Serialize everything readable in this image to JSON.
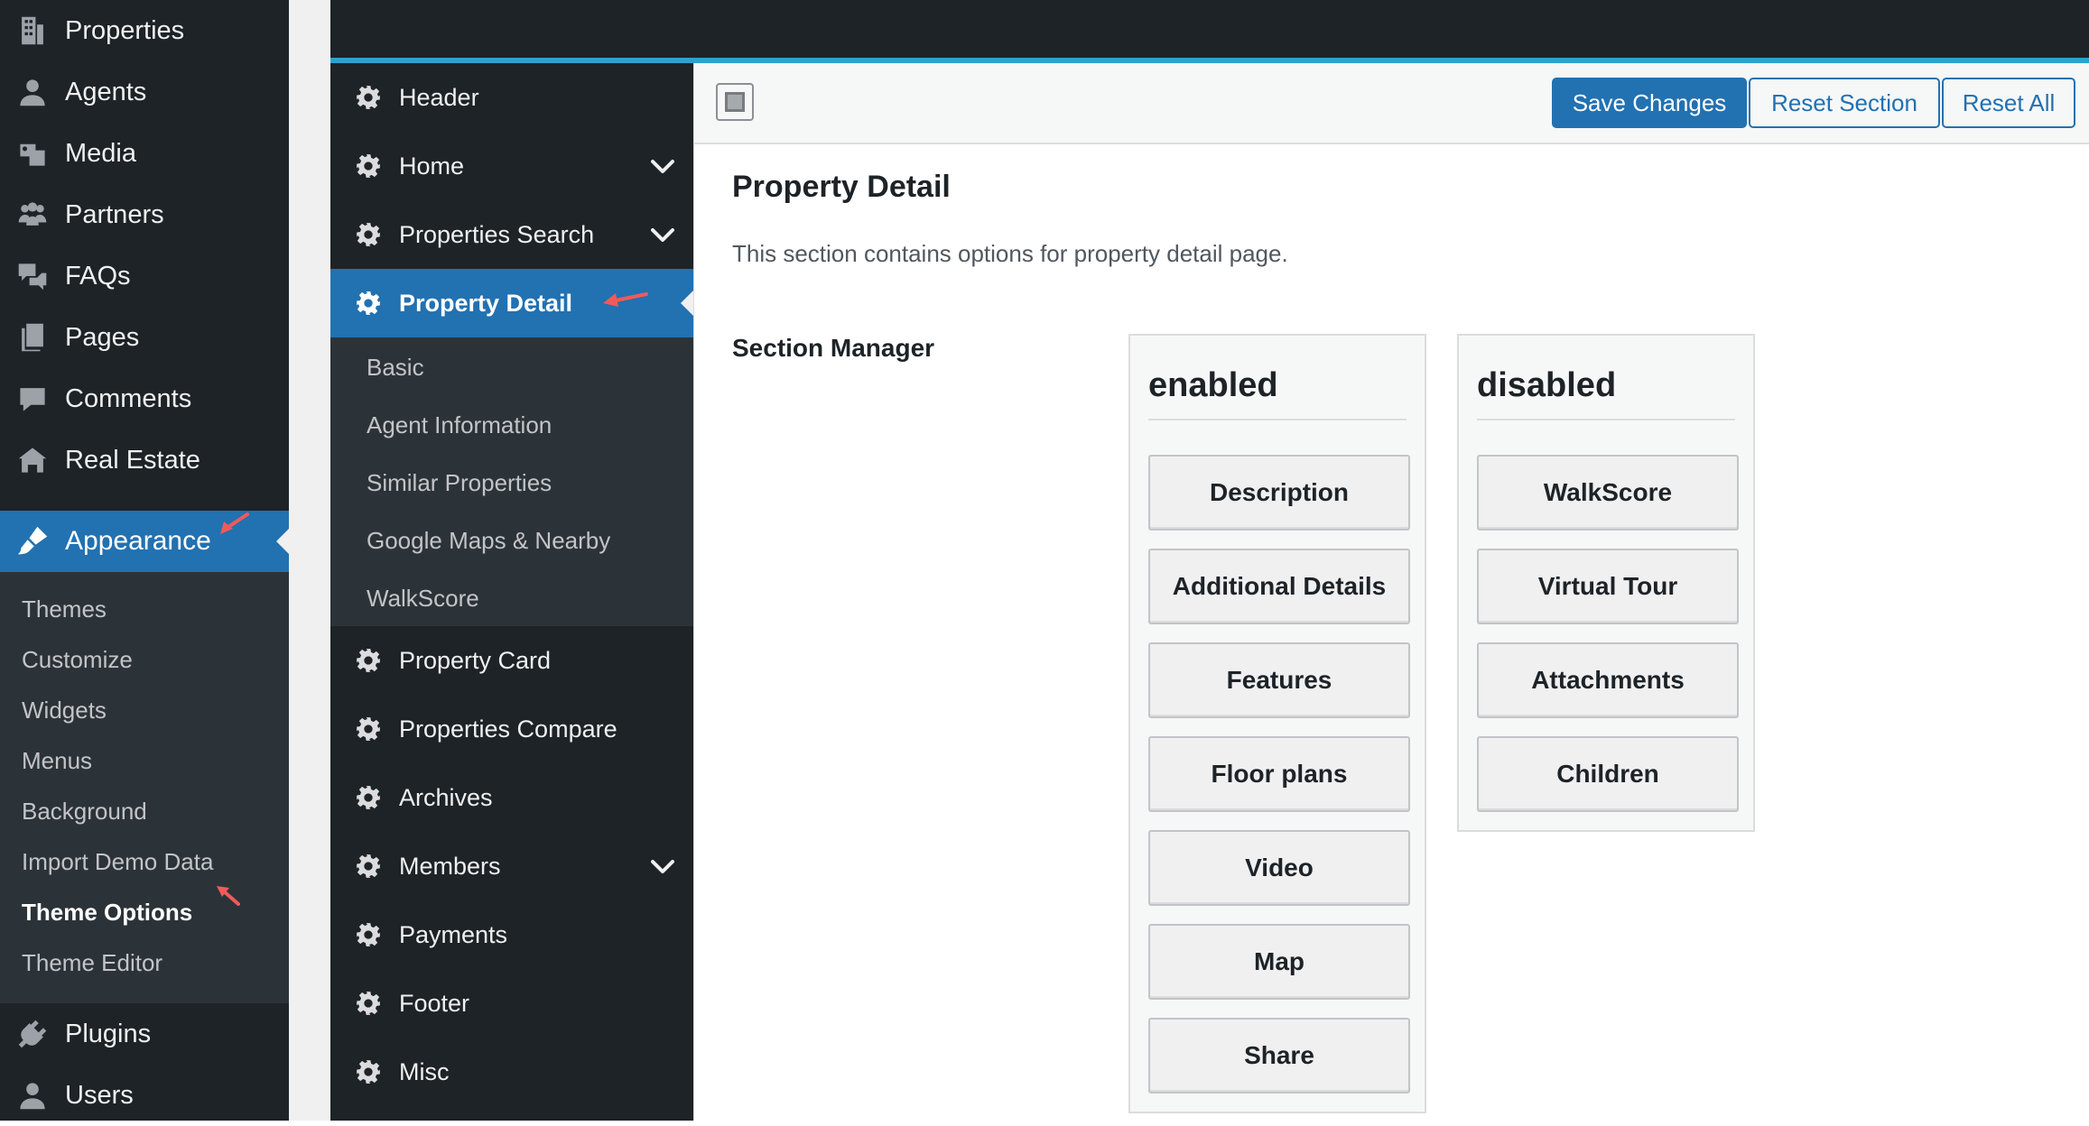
{
  "wp_menu": {
    "items_top": [
      {
        "label": "Properties",
        "icon": "building-icon"
      },
      {
        "label": "Agents",
        "icon": "person-icon"
      },
      {
        "label": "Media",
        "icon": "media-icon"
      },
      {
        "label": "Partners",
        "icon": "groups-icon"
      },
      {
        "label": "FAQs",
        "icon": "speech-bubbles-icon"
      },
      {
        "label": "Pages",
        "icon": "pages-icon"
      },
      {
        "label": "Comments",
        "icon": "comment-icon"
      },
      {
        "label": "Real Estate",
        "icon": "houses-icon"
      }
    ],
    "appearance": {
      "label": "Appearance",
      "icon": "paintbrush-icon"
    },
    "appearance_submenu": [
      "Themes",
      "Customize",
      "Widgets",
      "Menus",
      "Background",
      "Import Demo Data",
      "Theme Options",
      "Theme Editor"
    ],
    "items_bottom": [
      {
        "label": "Plugins",
        "icon": "plug-icon"
      },
      {
        "label": "Users",
        "icon": "person-icon"
      }
    ]
  },
  "options_menu": {
    "items": [
      {
        "label": "Header",
        "has_children": false
      },
      {
        "label": "Home",
        "has_children": true
      },
      {
        "label": "Properties Search",
        "has_children": true
      },
      {
        "label": "Property Detail",
        "has_children": false,
        "active": true
      },
      {
        "label": "Property Card",
        "has_children": false
      },
      {
        "label": "Properties Compare",
        "has_children": false
      },
      {
        "label": "Archives",
        "has_children": false
      },
      {
        "label": "Members",
        "has_children": true
      },
      {
        "label": "Payments",
        "has_children": false
      },
      {
        "label": "Footer",
        "has_children": false
      },
      {
        "label": "Misc",
        "has_children": false
      }
    ],
    "property_detail_sub": [
      "Basic",
      "Agent Information",
      "Similar Properties",
      "Google Maps & Nearby",
      "WalkScore"
    ]
  },
  "toolbar": {
    "save": "Save Changes",
    "reset_section": "Reset Section",
    "reset_all": "Reset All"
  },
  "main": {
    "title": "Property Detail",
    "description": "This section contains options for property detail page.",
    "field_label": "Section Manager",
    "enabled": {
      "heading": "enabled",
      "blocks": [
        "Description",
        "Additional Details",
        "Features",
        "Floor plans",
        "Video",
        "Map",
        "Share"
      ]
    },
    "disabled": {
      "heading": "disabled",
      "blocks": [
        "WalkScore",
        "Virtual Tour",
        "Attachments",
        "Children"
      ]
    }
  },
  "colors": {
    "admin_dark": "#1d2327",
    "submenu_dark": "#2c3338",
    "accent_blue": "#2271b1",
    "top_accent": "#2ea2cc",
    "annotation_arrow": "#f05a5a"
  }
}
